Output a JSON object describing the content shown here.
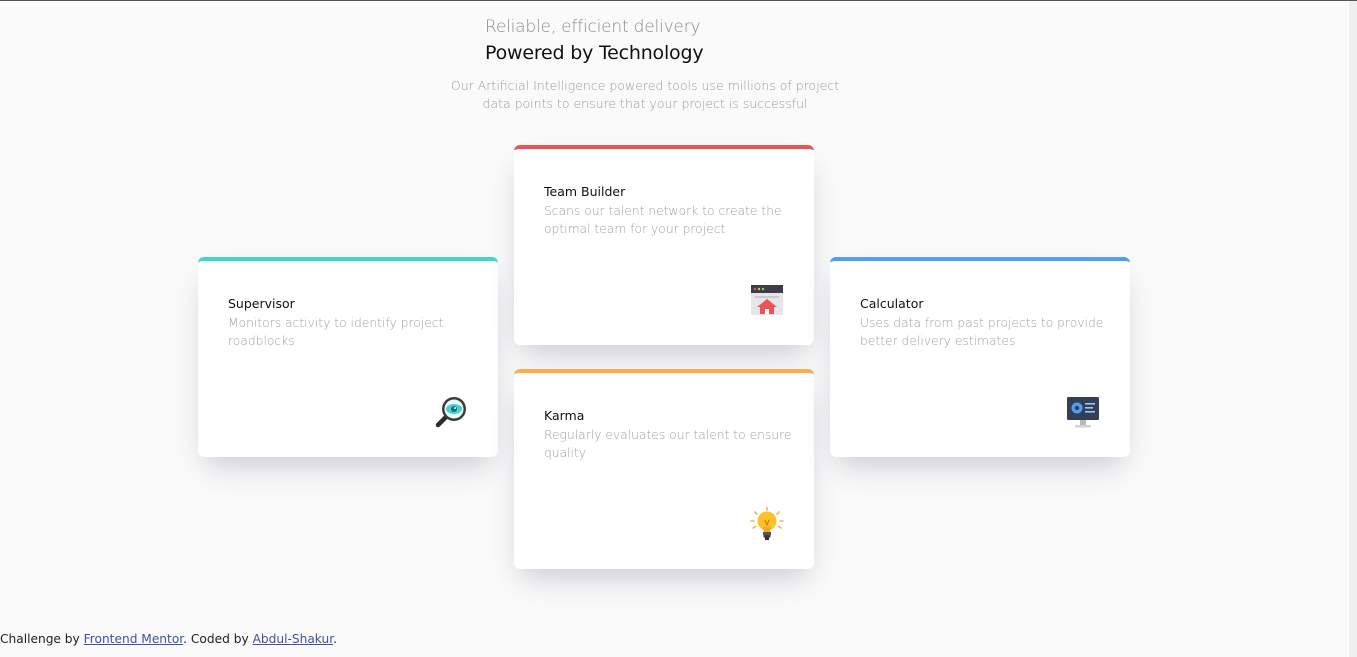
{
  "header": {
    "eyebrow": "Reliable, efficient delivery",
    "title": "Powered by Technology",
    "intro": "Our Artificial Intelligence powered tools use millions of project data points to ensure that your project is successful"
  },
  "cards": [
    {
      "title": "Supervisor",
      "description": "Monitors activity to identify project roadblocks",
      "icon": "magnifier-icon",
      "accent": "#44d3d2"
    },
    {
      "title": "Team Builder",
      "description": "Scans our talent network to create the optimal team for your project",
      "icon": "team-builder-icon",
      "accent": "#ea5454"
    },
    {
      "title": "Karma",
      "description": "Regularly evaluates our talent to ensure quality",
      "icon": "lightbulb-icon",
      "accent": "#fcae4a"
    },
    {
      "title": "Calculator",
      "description": "Uses data from past projects to provide better delivery estimates",
      "icon": "calculator-icon",
      "accent": "#549ef2"
    }
  ],
  "footer": {
    "prefix": "Challenge by ",
    "link1": "Frontend Mentor",
    "middle": ". Coded by ",
    "link2": "Abdul-Shakur",
    "suffix": "."
  }
}
